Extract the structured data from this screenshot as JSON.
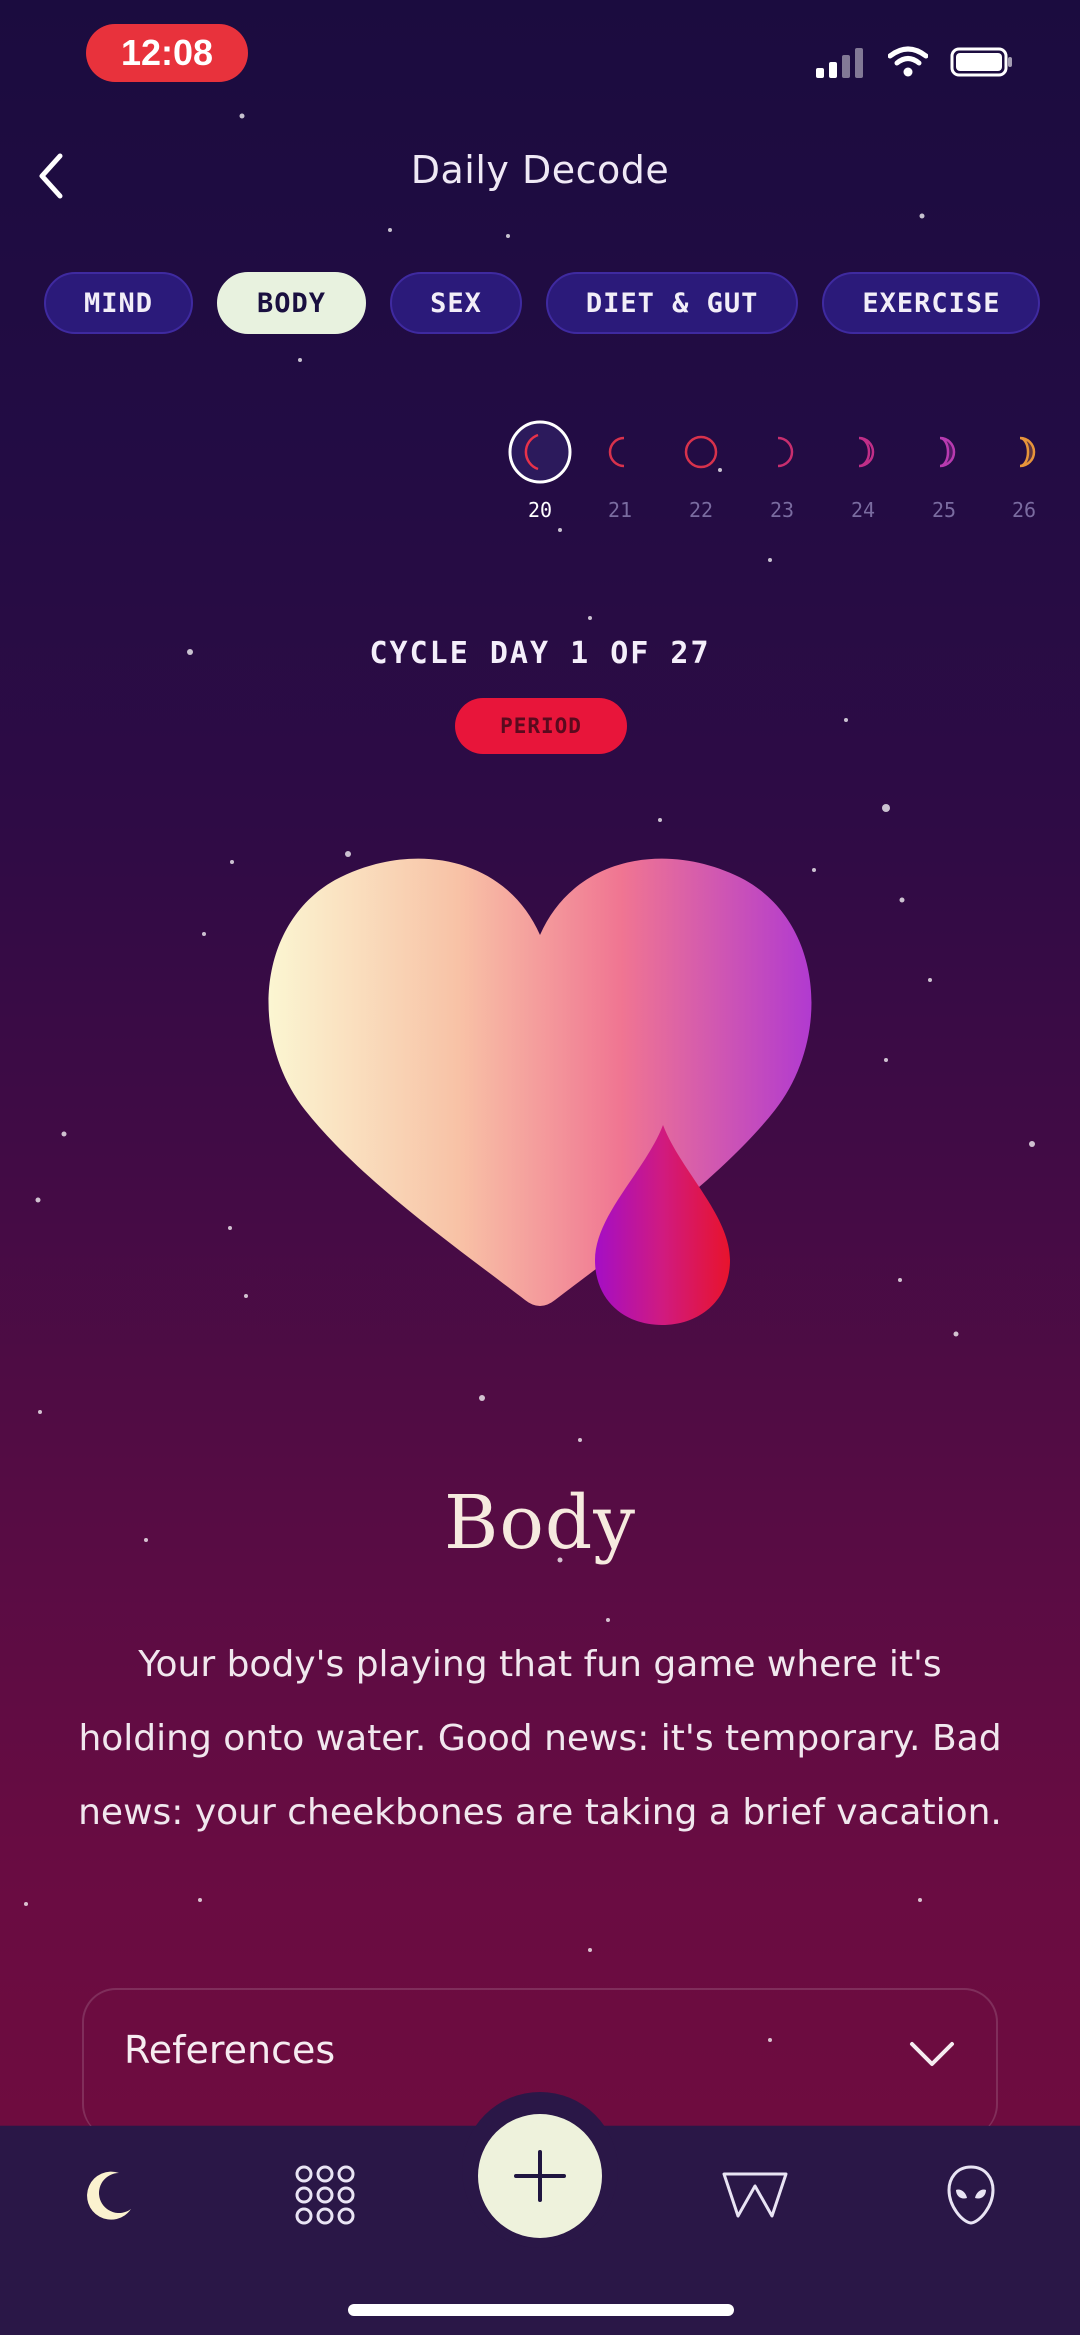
{
  "status_bar": {
    "time": "12:08"
  },
  "header": {
    "title": "Daily Decode"
  },
  "tabs": [
    {
      "label": "MIND"
    },
    {
      "label": "BODY"
    },
    {
      "label": "SEX"
    },
    {
      "label": "DIET & GUT"
    },
    {
      "label": "EXERCISE"
    }
  ],
  "active_tab": "BODY",
  "days": [
    {
      "num": "20"
    },
    {
      "num": "21"
    },
    {
      "num": "22"
    },
    {
      "num": "23"
    },
    {
      "num": "24"
    },
    {
      "num": "25"
    },
    {
      "num": "26"
    }
  ],
  "cycle": {
    "label": "CYCLE DAY 1 OF 27",
    "phase": "PERIOD"
  },
  "section": {
    "title": "Body",
    "description": "Your body's playing that fun game where it's holding onto water. Good news: it's temporary. Bad news: your cheekbones are taking a brief vacation."
  },
  "references": {
    "label": "References"
  },
  "nav": {
    "items": [
      "moon-icon",
      "grid-icon",
      "add-icon",
      "w-icon",
      "alien-icon"
    ]
  },
  "colors": {
    "accent_tab": "#2b1a7a",
    "active_tab": "#e8f2df",
    "period_badge": "#e8153a",
    "nav_bg": "#2a1747"
  }
}
